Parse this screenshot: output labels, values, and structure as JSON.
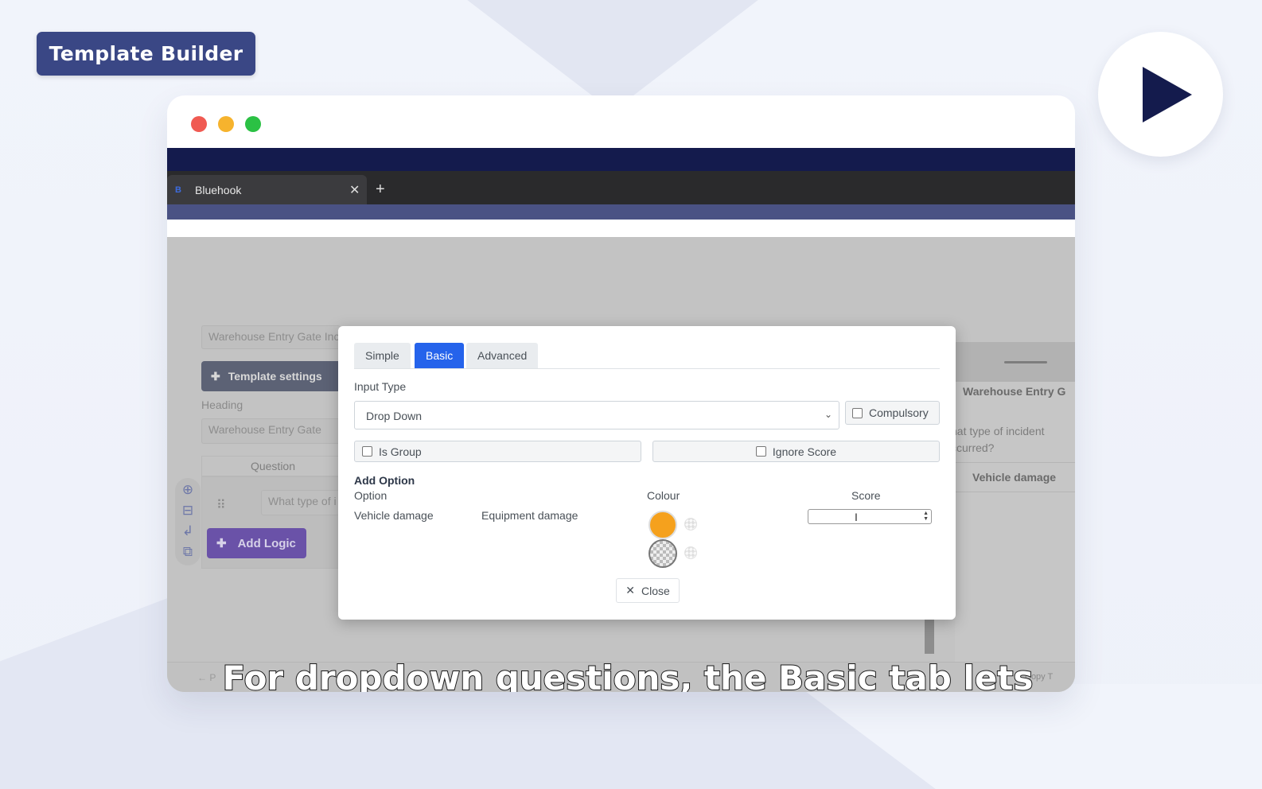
{
  "badge": {
    "title": "Template Builder"
  },
  "browser": {
    "tab_favicon": "B",
    "tab_title": "Bluehook",
    "tab_close": "✕",
    "new_tab": "+"
  },
  "background_app": {
    "template_name": "Warehouse Entry Gate Inc",
    "template_settings_label": "Template settings",
    "heading_label": "Heading",
    "heading_value": "Warehouse Entry Gate",
    "question_header": "Question",
    "question_placeholder": "What type of i",
    "add_logic_label": "Add Logic",
    "right_panel_title": "Warehouse Entry G",
    "right_panel_question": "hat type of incident ccurred?",
    "right_panel_option": "Vehicle damage",
    "copy_label": "Copy T",
    "back_label": "← P"
  },
  "modal": {
    "tabs": [
      {
        "label": "Simple",
        "active": false
      },
      {
        "label": "Basic",
        "active": true
      },
      {
        "label": "Advanced",
        "active": false
      }
    ],
    "input_type_label": "Input Type",
    "input_type_value": "Drop Down",
    "compulsory_label": "Compulsory",
    "is_group_label": "Is Group",
    "ignore_score_label": "Ignore Score",
    "add_option_label": "Add Option",
    "option_header": "Option",
    "colour_header": "Colour",
    "score_header": "Score",
    "options": [
      "Vehicle damage",
      "Equipment damage"
    ],
    "swatch_colors": [
      "#f5a11d",
      "transparent"
    ],
    "close_label": "Close"
  },
  "caption": "For dropdown questions, the Basic tab lets",
  "colors": {
    "accent": "#2563eb",
    "brand_navy": "#141b4d",
    "badge": "#3a4785",
    "add_logic": "#6a52a8"
  }
}
